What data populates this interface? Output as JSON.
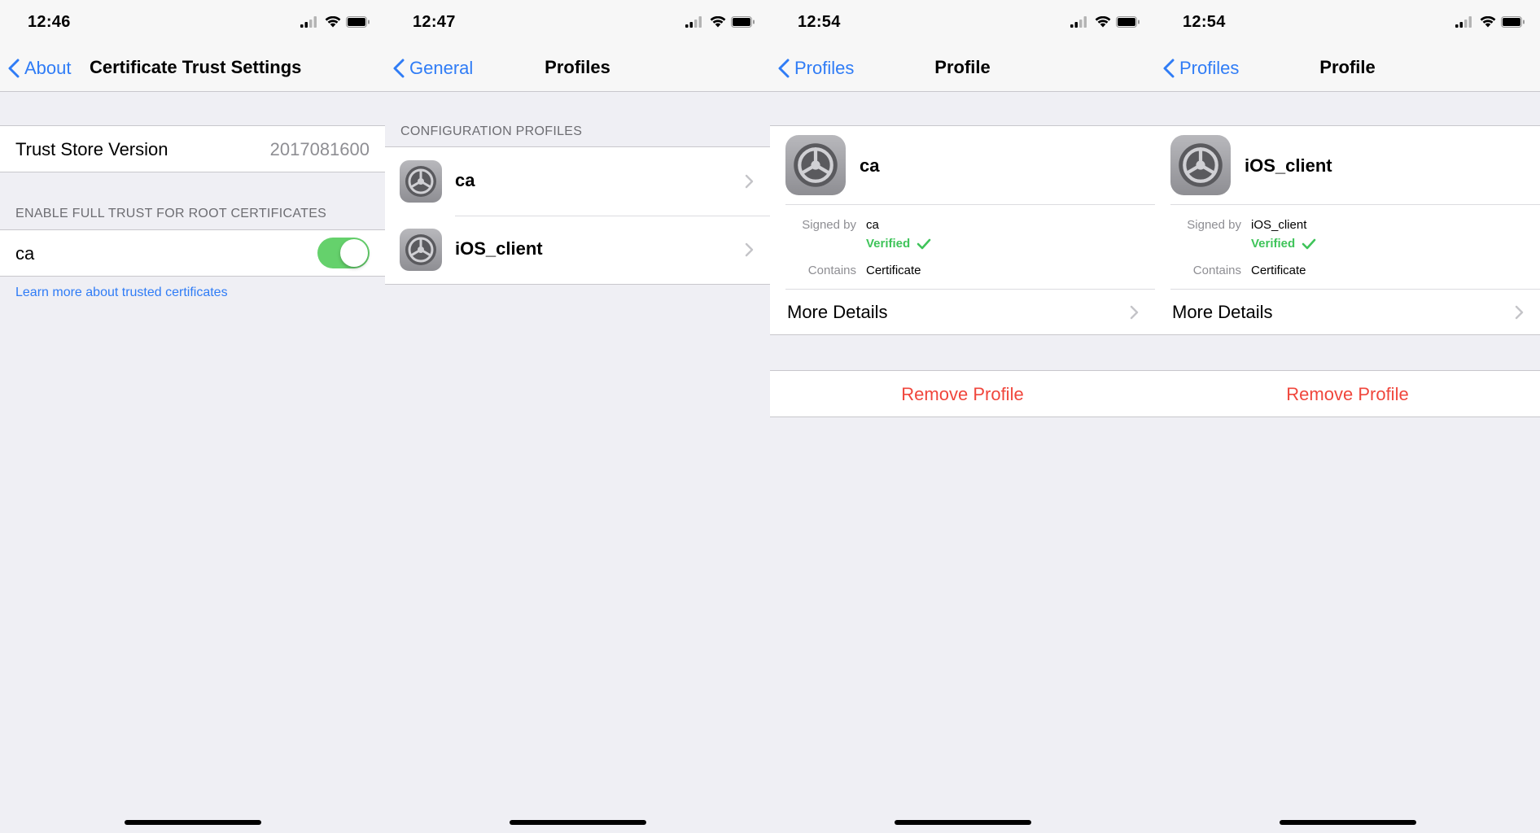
{
  "screens": [
    {
      "status_time": "12:46",
      "back_label": "About",
      "title": "Certificate Trust Settings",
      "trust_store_label": "Trust Store Version",
      "trust_store_value": "2017081600",
      "section_header": "ENABLE FULL TRUST FOR ROOT CERTIFICATES",
      "cert_row_label": "ca",
      "cert_toggle_on": true,
      "learn_more_link": "Learn more about trusted certificates"
    },
    {
      "status_time": "12:47",
      "back_label": "General",
      "title": "Profiles",
      "section_header": "CONFIGURATION PROFILES",
      "profiles": [
        {
          "name": "ca"
        },
        {
          "name": "iOS_client"
        }
      ]
    },
    {
      "status_time": "12:54",
      "back_label": "Profiles",
      "title": "Profile",
      "profile_name": "ca",
      "signed_by_label": "Signed by",
      "signed_by_value": "ca",
      "verified_label": "Verified",
      "contains_label": "Contains",
      "contains_value": "Certificate",
      "more_details": "More Details",
      "remove_profile": "Remove Profile"
    },
    {
      "status_time": "12:54",
      "back_label": "Profiles",
      "title": "Profile",
      "profile_name": "iOS_client",
      "signed_by_label": "Signed by",
      "signed_by_value": "iOS_client",
      "verified_label": "Verified",
      "contains_label": "Contains",
      "contains_value": "Certificate",
      "more_details": "More Details",
      "remove_profile": "Remove Profile"
    }
  ],
  "colors": {
    "accent_blue": "#2f7cf6",
    "toggle_green": "#65d16c",
    "verified_green": "#3fc45a",
    "destructive_red": "#f0463c",
    "background": "#efeff4"
  }
}
